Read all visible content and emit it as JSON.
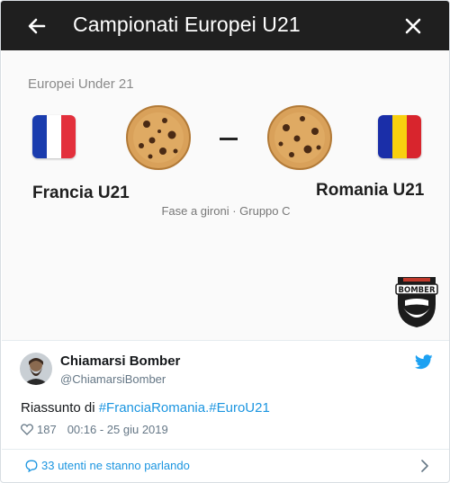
{
  "header": {
    "title": "Campionati Europei U21",
    "back_icon": "arrow-left-icon",
    "close_icon": "close-icon",
    "background": "#1f1f1f"
  },
  "match": {
    "competition": "Europei Under 21",
    "home_team": "Francia U21",
    "away_team": "Romania U21",
    "separator": "–",
    "stage": "Fase a gironi · Gruppo C",
    "home_flag_colors": [
      "#1a3cae",
      "#ffffff",
      "#e3303c"
    ],
    "away_flag_colors": [
      "#1a2ea8",
      "#f8d00f",
      "#d8252d"
    ],
    "logo_text": "BOMBER"
  },
  "tweet": {
    "author_name": "Chiamarsi Bomber",
    "author_handle": "@ChiamarsiBomber",
    "text_prefix": "Riassunto di ",
    "hashtag_1": "#FranciaRomania",
    "hashtag_2": ".#EuroU21",
    "likes": "187",
    "timestamp": "00:16 - 25 giu 2019",
    "conversation": "33 utenti ne stanno parlando",
    "link_color": "#1b95e0"
  }
}
